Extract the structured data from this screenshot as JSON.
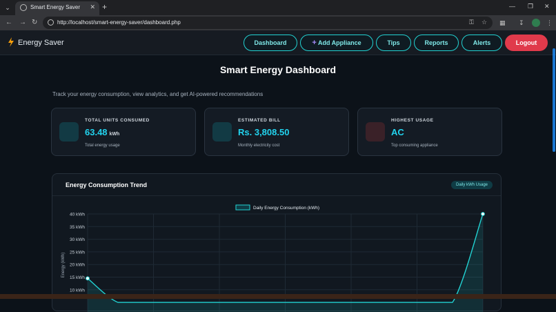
{
  "browser": {
    "tab_title": "Smart Energy Saver",
    "new_tab": "+",
    "url": "http://localhost/smart-energy-saver/dashboard.php",
    "icons": [
      "tab-menu-icon",
      "site-icon",
      "close-icon",
      "back-icon",
      "forward-icon",
      "reload-icon",
      "info-icon",
      "password-key-icon",
      "bookmark-star-icon",
      "extensions-icon",
      "download-icon",
      "profile-icon",
      "menu-dots-icon",
      "minimize-icon",
      "maximize-icon",
      "window-close-icon"
    ]
  },
  "nav": {
    "brand": "Energy Saver",
    "brand_icon": "lightning-icon",
    "items": [
      {
        "label": "Dashboard"
      },
      {
        "label": "Add Appliance",
        "prefix": "+"
      },
      {
        "label": "Tips"
      },
      {
        "label": "Reports"
      },
      {
        "label": "Alerts"
      }
    ],
    "logout": "Logout"
  },
  "page": {
    "title": "Smart Energy Dashboard",
    "subtitle": "Track your energy consumption, view analytics, and get AI-powered recommendations"
  },
  "cards": [
    {
      "label": "TOTAL UNITS CONSUMED",
      "value": "63.48",
      "unit": "kWh",
      "note": "Total energy usage",
      "icon_color": "#123a44"
    },
    {
      "label": "ESTIMATED BILL",
      "value": "Rs. 3,808.50",
      "unit": "",
      "note": "Monthly electricity cost",
      "icon_color": "#123a44"
    },
    {
      "label": "HIGHEST USAGE",
      "value": "AC",
      "unit": "",
      "note": "Top consuming appliance",
      "icon_color": "#3a2128"
    }
  ],
  "chart_panel": {
    "title": "Energy Consumption Trend",
    "badge": "Daily kWh Usage"
  },
  "colors": {
    "accent": "#22d3d3",
    "logout": "#e03a4b",
    "value": "#22d3ee"
  },
  "chart_data": {
    "type": "line",
    "legend": "Daily Energy Consumption (kWh)",
    "ylabel": "Energy (kWh)",
    "yticks": [
      "40 kWh",
      "35 kWh",
      "30 kWh",
      "25 kWh",
      "20 kWh",
      "15 kWh",
      "10 kWh"
    ],
    "ylim": [
      5,
      40
    ],
    "x": [
      0,
      1,
      2,
      3,
      4,
      5,
      6,
      7,
      8,
      9,
      10,
      11,
      12,
      13
    ],
    "series": [
      {
        "name": "Daily Energy Consumption (kWh)",
        "values": [
          14.5,
          5,
          5,
          5,
          5,
          5,
          5,
          5,
          5,
          5,
          5,
          5,
          5,
          40
        ]
      }
    ],
    "grid": true,
    "legend_position": "top-center"
  }
}
